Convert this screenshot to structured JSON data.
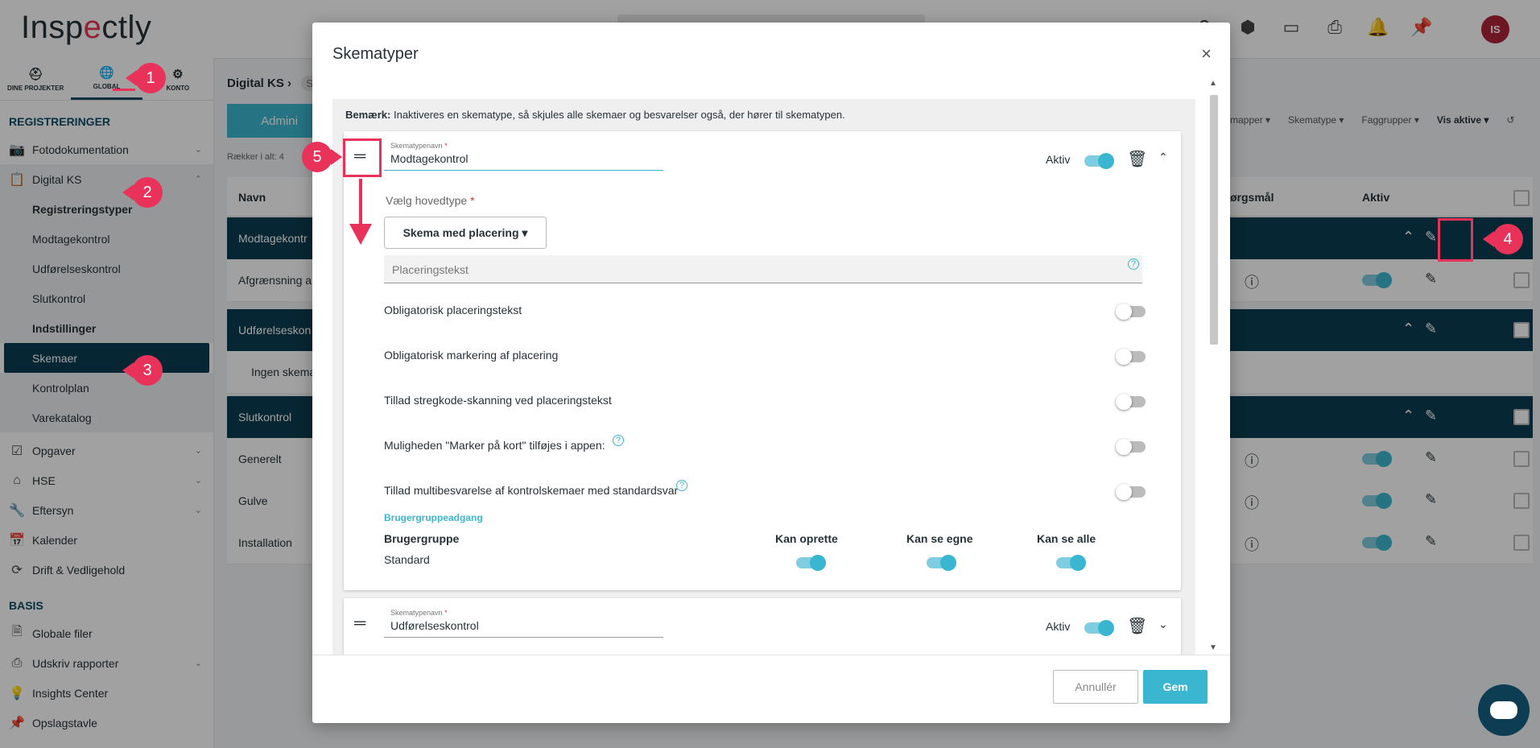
{
  "app": {
    "logo": "Inspectly",
    "user_initials": "IS",
    "top_icons": [
      "plan-icon",
      "boxes-icon",
      "devices-icon",
      "printer-icon",
      "bell-icon",
      "pin-icon"
    ]
  },
  "sidebar": {
    "tabs": [
      {
        "label": "DINE PROJEKTER",
        "icon": "helmet-icon"
      },
      {
        "label": "GLOBAL",
        "icon": "globe-icon"
      },
      {
        "label": "KONTO",
        "icon": "gear-icon"
      }
    ],
    "registreringer_title": "REGISTRERINGER",
    "fotodok": "Fotodokumentation",
    "digitalks": "Digital KS",
    "sub_items": [
      "Registreringstyper",
      "Modtagekontrol",
      "Udførelseskontrol",
      "Slutkontrol",
      "Indstillinger",
      "Skemaer",
      "Kontrolplan",
      "Varekatalog"
    ],
    "opgaver": "Opgaver",
    "hse": "HSE",
    "eftersyn": "Eftersyn",
    "kalender": "Kalender",
    "drift": "Drift & Vedligehold",
    "basis_title": "BASIS",
    "globale": "Globale filer",
    "udskriv": "Udskriv rapporter",
    "insights": "Insights Center",
    "opslag": "Opslagstavle"
  },
  "main": {
    "breadcrumb": "Digital KS",
    "breadcrumb_next": "Sk",
    "admin_btn": "Admini",
    "row_count": "Rækker i alt: 4",
    "filters": [
      "mapper",
      "Skematype",
      "Faggrupper",
      "Vis aktive"
    ],
    "col_navn": "Navn",
    "col_sporgsmal": "ørgsmål",
    "col_aktiv": "Aktiv",
    "groups": [
      "Modtagekontr",
      "Udførelseskon",
      "Slutkontrol"
    ],
    "rows": [
      "Afgrænsning a",
      "Ingen skema",
      "Generelt",
      "Gulve",
      "Installation"
    ]
  },
  "modal": {
    "title": "Skematyper",
    "note_bold": "Bemærk:",
    "note_text": " Inaktiveres en skematype, så skjules alle skemaer og besvarelser også, der hører til skematypen.",
    "field_label": "Skematypenavn",
    "req": "*",
    "card1_value": "Modtagekontrol",
    "card2_value": "Udførelseskontrol",
    "aktiv": "Aktiv",
    "hovedtype_label": "Vælg hovedtype",
    "hovedtype_value": "Skema med placering",
    "placering_placeholder": "Placeringstekst",
    "options": [
      "Obligatorisk placeringstekst",
      "Obligatorisk markering af placering",
      "Tillad stregkode-skanning ved placeringstekst",
      "Muligheden \"Marker på kort\" tilføjes i appen:",
      "Tillad multibesvarelse af kontrolskemaer med standardsvar"
    ],
    "brugergruppe_section": "Brugergruppeadgang",
    "headers": {
      "gruppe": "Brugergruppe",
      "opret": "Kan oprette",
      "egne": "Kan se egne",
      "alle": "Kan se alle"
    },
    "gruppe_value": "Standard",
    "cancel": "Annullér",
    "save": "Gem"
  },
  "annotations": [
    "1",
    "2",
    "3",
    "4",
    "5"
  ],
  "colors": {
    "accent": "#3bb6d0",
    "dark": "#0c3d52",
    "annotation": "#e8325a"
  }
}
